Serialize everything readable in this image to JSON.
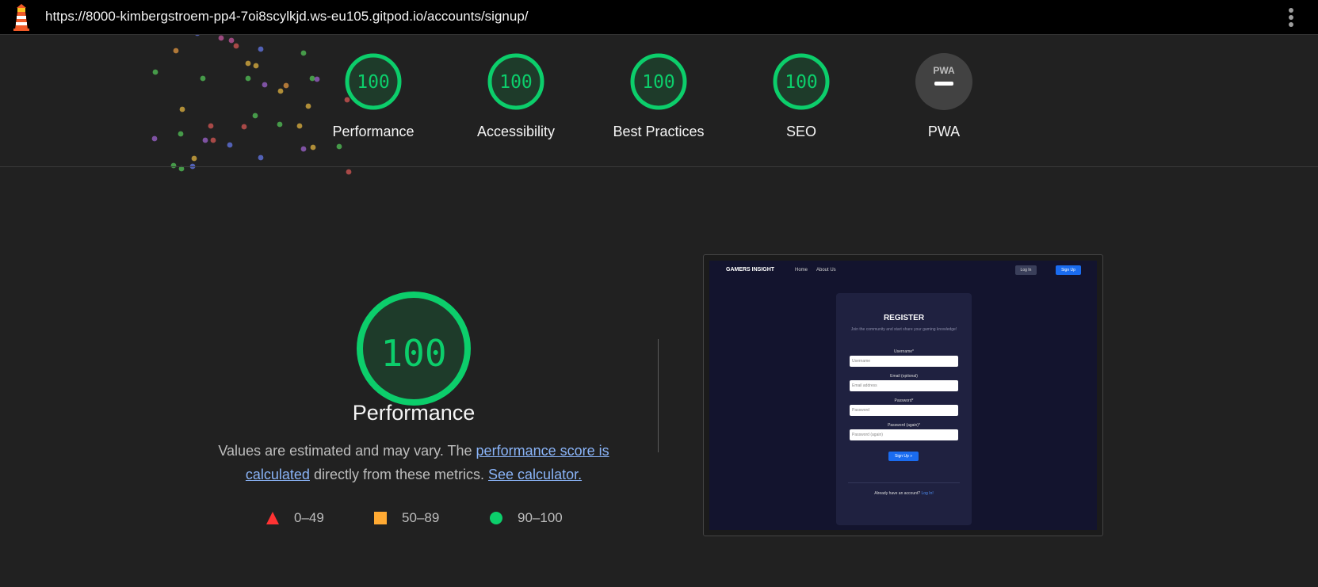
{
  "topbar": {
    "url": "https://8000-kimbergstroem-pp4-7oi8scylkjd.ws-eu105.gitpod.io/accounts/signup/",
    "logo_icon": "lighthouse-icon",
    "menu_icon": "kebab-menu-icon"
  },
  "summary": {
    "gauges": [
      {
        "label": "Performance",
        "score": "100"
      },
      {
        "label": "Accessibility",
        "score": "100"
      },
      {
        "label": "Best Practices",
        "score": "100"
      },
      {
        "label": "SEO",
        "score": "100"
      },
      {
        "label": "PWA",
        "badge": "PWA"
      }
    ]
  },
  "main": {
    "score": "100",
    "title": "Performance",
    "desc_prefix": "Values are estimated and may vary. The ",
    "desc_link1": "performance score is calculated",
    "desc_middle": " directly from these metrics. ",
    "desc_link2": "See calculator.",
    "legend": [
      {
        "range": "0–49",
        "icon": "triangle-icon",
        "color": "#ff3333"
      },
      {
        "range": "50–89",
        "icon": "square-icon",
        "color": "#ffaa33"
      },
      {
        "range": "90–100",
        "icon": "circle-icon",
        "color": "#0cce6b"
      }
    ]
  },
  "screenshot": {
    "brand": "GAMERS INSIGHT",
    "nav_home": "Home",
    "nav_about": "About Us",
    "login": "Log In",
    "signup": "Sign Up",
    "heading": "REGISTER",
    "subtitle": "Join the community and start share your gaming knowledge!",
    "fields": [
      {
        "label": "Username*",
        "placeholder": "Username"
      },
      {
        "label": "Email (optional)",
        "placeholder": "Email address"
      },
      {
        "label": "Password*",
        "placeholder": "Password"
      },
      {
        "label": "Password (again)*",
        "placeholder": "Password (again)"
      }
    ],
    "submit": "Sign Up »",
    "already": "Already have an account?",
    "already_link": "Log In!"
  },
  "colors": {
    "pass": "#0cce6b",
    "pass_fill": "#1e3b2a",
    "background": "#212121",
    "link": "#8ab4f8"
  }
}
